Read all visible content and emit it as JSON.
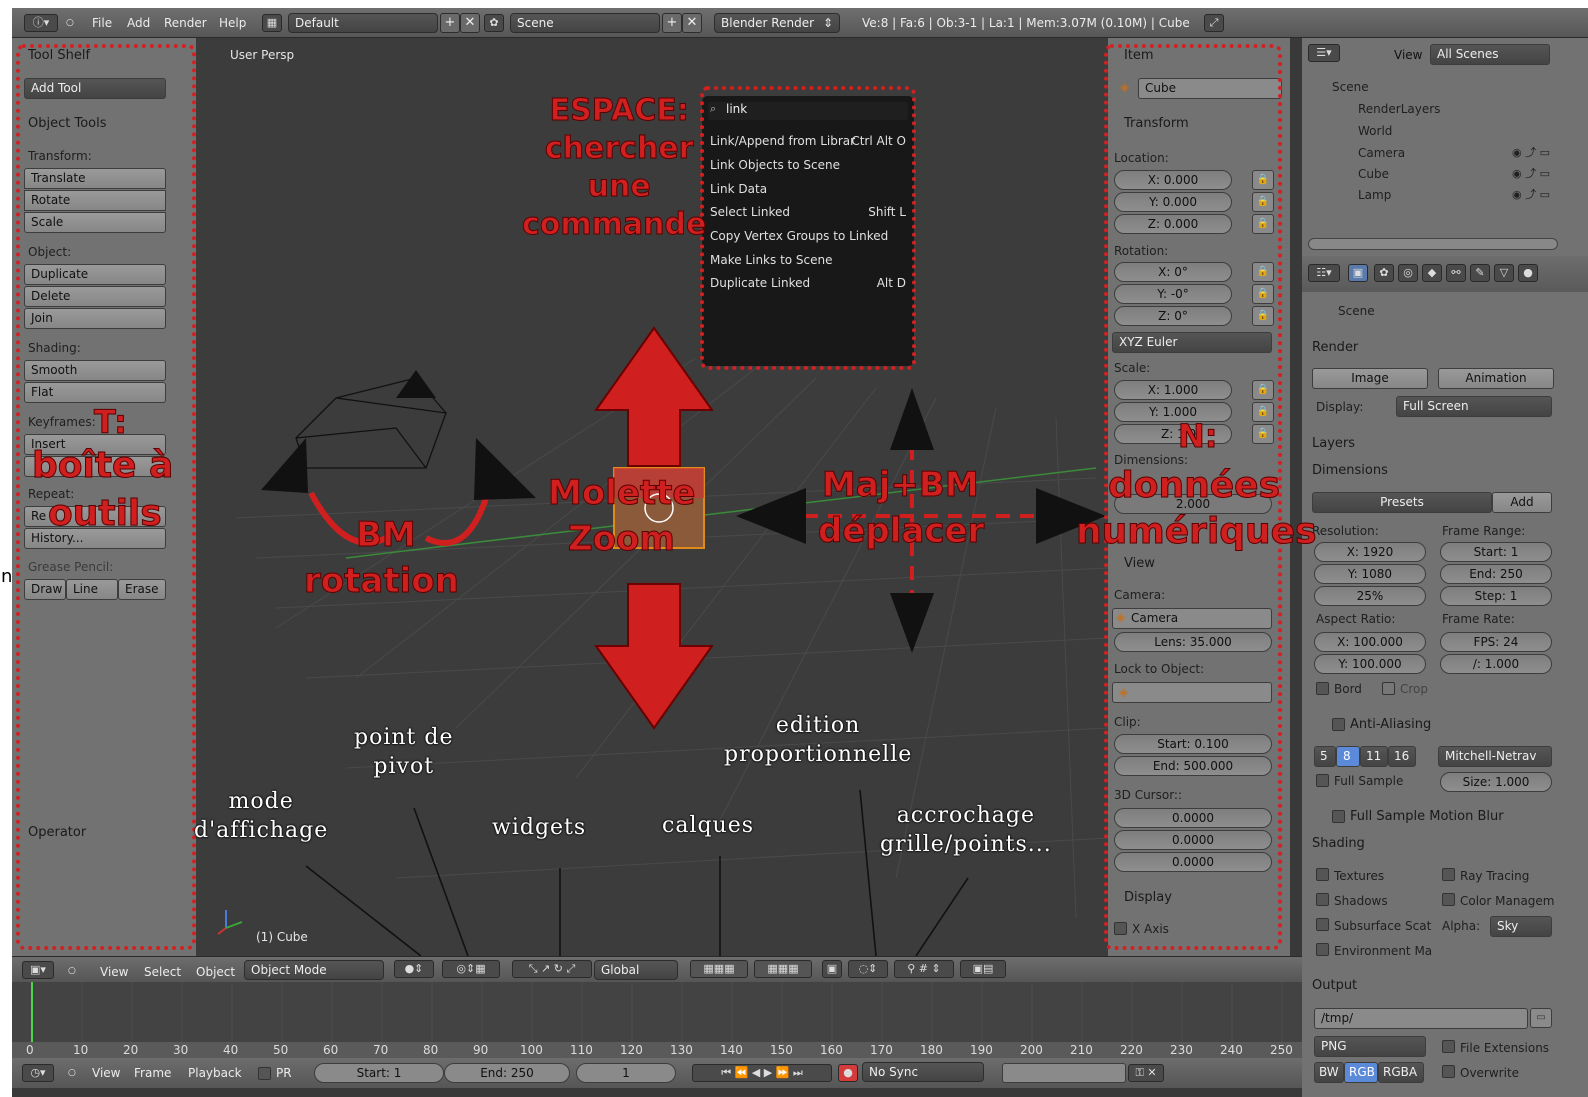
{
  "topbar": {
    "menus": [
      "File",
      "Add",
      "Render",
      "Help"
    ],
    "layout": "Default",
    "scene": "Scene",
    "engine": "Blender Render",
    "stats": "Ve:8 | Fa:6 | Ob:3-1 | La:1 | Mem:3.07M (0.10M) | Cube"
  },
  "toolshelf": {
    "title": "Tool Shelf",
    "add_tool": "Add Tool",
    "object_tools": "Object Tools",
    "transform_label": "Transform:",
    "translate": "Translate",
    "rotate": "Rotate",
    "scale": "Scale",
    "object_label": "Object:",
    "duplicate": "Duplicate",
    "delete": "Delete",
    "join": "Join",
    "shading_label": "Shading:",
    "smooth": "Smooth",
    "flat": "Flat",
    "keyframes_label": "Keyframes:",
    "insert": "Insert",
    "repeat_label": "Repeat:",
    "repeat_last": "Re",
    "history": "History...",
    "grease_label": "Grease Pencil:",
    "draw": "Draw",
    "line": "Line",
    "erase": "Erase",
    "operator": "Operator"
  },
  "viewport": {
    "view_label": "User Persp",
    "object_label": "(1) Cube"
  },
  "search_popup": {
    "query": "link",
    "items": [
      {
        "label": "Link/Append from Librar",
        "key": "Ctrl Alt O"
      },
      {
        "label": "Link Objects to Scene",
        "key": ""
      },
      {
        "label": "Link Data",
        "key": ""
      },
      {
        "label": "Select Linked",
        "key": "Shift L"
      },
      {
        "label": "Copy Vertex Groups to Linked",
        "key": ""
      },
      {
        "label": "Make Links to Scene",
        "key": ""
      },
      {
        "label": "Duplicate Linked",
        "key": "Alt D"
      }
    ]
  },
  "npanel": {
    "item": "Item",
    "object_name": "Cube",
    "transform": "Transform",
    "location_label": "Location:",
    "loc_x": "X: 0.000",
    "loc_y": "Y: 0.000",
    "loc_z": "Z: 0.000",
    "rotation_label": "Rotation:",
    "rot_x": "X: 0°",
    "rot_y": "Y: -0°",
    "rot_z": "Z: 0°",
    "rot_mode": "XYZ Euler",
    "scale_label": "Scale:",
    "scale_x": "X: 1.000",
    "scale_y": "Y: 1.000",
    "scale_z": "Z: 1.0",
    "dimensions_label": "Dimensions:",
    "dim_y": "2.000",
    "view": "View",
    "camera_label": "Camera:",
    "camera": "Camera",
    "lens": "Lens: 35.000",
    "lock_label": "Lock to Object:",
    "clip_label": "Clip:",
    "clip_start": "Start: 0.100",
    "clip_end": "End: 500.000",
    "cursor_label": "3D Cursor::",
    "cursor_x": "0.0000",
    "cursor_y": "0.0000",
    "cursor_z": "0.0000",
    "display": "Display",
    "x_axis": "X Axis"
  },
  "outliner": {
    "view": "View",
    "filter": "All Scenes",
    "items": [
      "Scene",
      "RenderLayers",
      "World",
      "Camera",
      "Cube",
      "Lamp"
    ]
  },
  "properties": {
    "scene": "Scene",
    "render": "Render",
    "image": "Image",
    "animation": "Animation",
    "display_label": "Display:",
    "display_value": "Full Screen",
    "layers": "Layers",
    "dimensions": "Dimensions",
    "presets": "Presets",
    "add": "Add",
    "resolution_label": "Resolution:",
    "frame_range_label": "Frame Range:",
    "res_x": "X: 1920",
    "res_y": "Y: 1080",
    "res_pct": "25%",
    "start": "Start: 1",
    "end": "End: 250",
    "step": "Step: 1",
    "aspect_label": "Aspect Ratio:",
    "frame_rate_label": "Frame Rate:",
    "aspect_x": "X: 100.000",
    "aspect_y": "Y: 100.000",
    "fps": "FPS: 24",
    "fps_base": "/: 1.000",
    "border": "Bord",
    "crop": "Crop",
    "anti_aliasing": "Anti-Aliasing",
    "aa_samples": [
      "5",
      "8",
      "11",
      "16"
    ],
    "aa_filter": "Mitchell-Netrav",
    "full_sample": "Full Sample",
    "size": "Size: 1.000",
    "motion_blur": "Full Sample Motion Blur",
    "shading": "Shading",
    "textures": "Textures",
    "ray_tracing": "Ray Tracing",
    "shadows": "Shadows",
    "color_management": "Color Managem",
    "subsurface": "Subsurface Scat",
    "alpha_label": "Alpha:",
    "alpha_value": "Sky",
    "environment": "Environment Ma",
    "output": "Output",
    "path": "/tmp/",
    "format": "PNG",
    "file_extensions": "File Extensions",
    "bw": "BW",
    "rgb": "RGB",
    "rgba": "RGBA",
    "overwrite": "Overwrite"
  },
  "header3d": {
    "view": "View",
    "select": "Select",
    "object": "Object",
    "mode": "Object Mode",
    "orientation": "Global"
  },
  "timeline": {
    "ticks": [
      "0",
      "10",
      "20",
      "30",
      "40",
      "50",
      "60",
      "70",
      "80",
      "90",
      "100",
      "110",
      "120",
      "130",
      "140",
      "150",
      "160",
      "170",
      "180",
      "190",
      "200",
      "210",
      "220",
      "230",
      "240",
      "250"
    ],
    "view": "View",
    "frame": "Frame",
    "playback": "Playback",
    "pr": "PR",
    "start": "Start: 1",
    "end": "End: 250",
    "current": "1",
    "sync": "No Sync"
  },
  "annotations": {
    "espace_1": "ESPACE:",
    "espace_2": "chercher",
    "espace_3": "une",
    "espace_4": "commande",
    "t_1": "T:",
    "t_2": "boîte à",
    "t_3": "outils",
    "bm_1": "BM",
    "bm_2": "rotation",
    "molette_1": "Molette",
    "molette_2": "Zoom",
    "maj_1": "Maj+BM",
    "maj_2": "déplacer",
    "n_1": "N:",
    "n_2": "données",
    "n_3": "numériques",
    "point_pivot": "point de\npivot",
    "mode_affichage": "mode\nd'affichage",
    "widgets": "widgets",
    "calques": "calques",
    "edition": "edition\nproportionnelle",
    "accrochage": "accrochage\ngrille/points...",
    "edge_glyph": "n"
  }
}
